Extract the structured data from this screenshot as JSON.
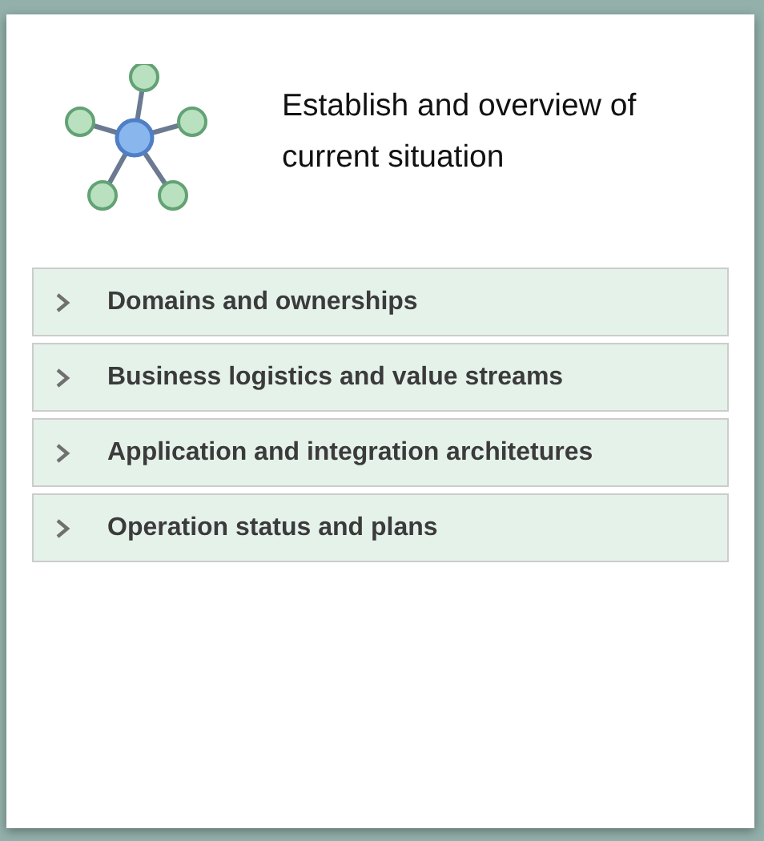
{
  "card": {
    "title": "Establish and overview of current situation"
  },
  "sections": [
    {
      "label": "Domains and ownerships",
      "expanded": false
    },
    {
      "label": "Business logistics and value streams",
      "expanded": false
    },
    {
      "label": "Application and integration architetures",
      "expanded": false
    },
    {
      "label": "Operation status and plans",
      "expanded": false
    }
  ]
}
